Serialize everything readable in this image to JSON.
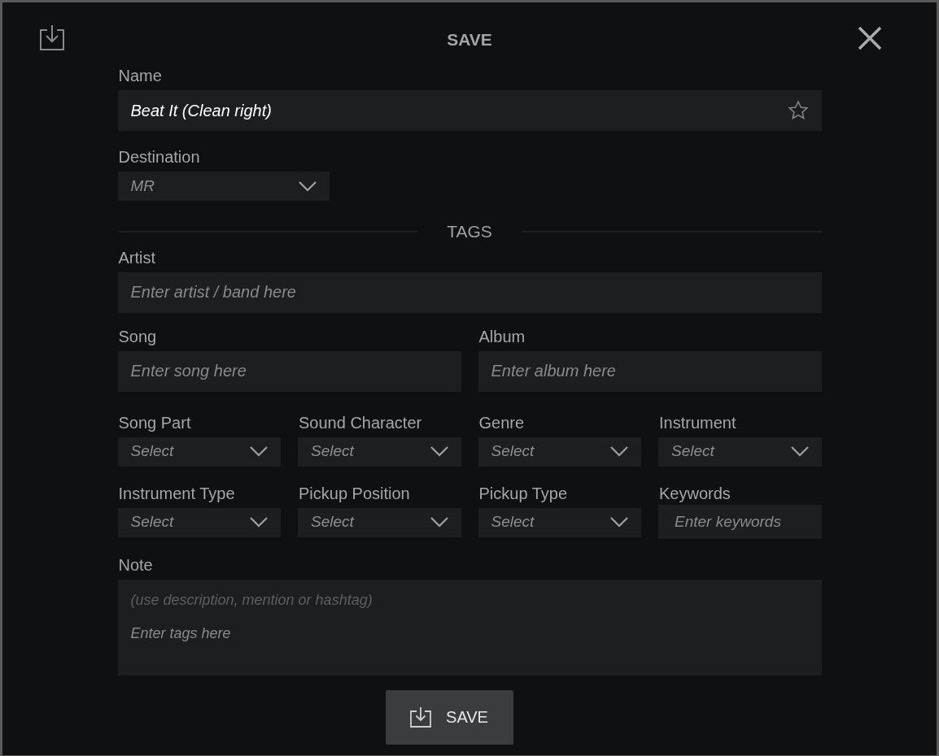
{
  "header": {
    "title": "SAVE"
  },
  "name": {
    "label": "Name",
    "value": "Beat It (Clean right)",
    "favorite": false
  },
  "destination": {
    "label": "Destination",
    "value": "MR"
  },
  "tags_heading": "TAGS",
  "artist": {
    "label": "Artist",
    "placeholder": "Enter artist / band here"
  },
  "song": {
    "label": "Song",
    "placeholder": "Enter song here"
  },
  "album": {
    "label": "Album",
    "placeholder": "Enter album here"
  },
  "tag_fields": [
    {
      "kind": "select",
      "label": "Song Part",
      "value": "Select"
    },
    {
      "kind": "select",
      "label": "Sound Character",
      "value": "Select"
    },
    {
      "kind": "select",
      "label": "Genre",
      "value": "Select"
    },
    {
      "kind": "select",
      "label": "Instrument",
      "value": "Select"
    },
    {
      "kind": "select",
      "label": "Instrument Type",
      "value": "Select"
    },
    {
      "kind": "select",
      "label": "Pickup Position",
      "value": "Select"
    },
    {
      "kind": "select",
      "label": "Pickup Type",
      "value": "Select"
    },
    {
      "kind": "input",
      "label": "Keywords",
      "placeholder": "Enter keywords"
    }
  ],
  "note": {
    "label": "Note",
    "hint": "(use description, mention or hashtag)",
    "placeholder": "Enter tags here"
  },
  "save_button": "SAVE"
}
